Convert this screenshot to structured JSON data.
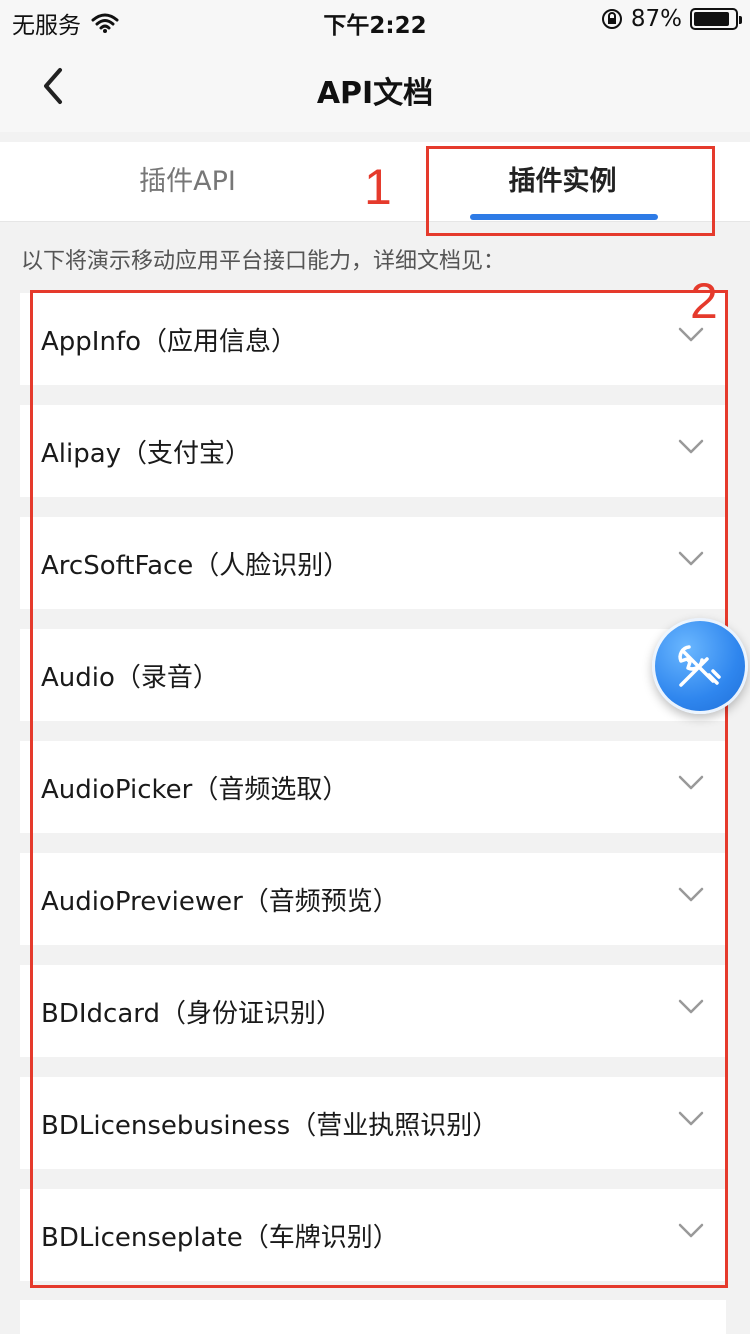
{
  "status_bar": {
    "carrier": "无服务",
    "time": "下午2:22",
    "battery_percent": "87%",
    "battery_level": 0.87
  },
  "nav": {
    "title": "API文档"
  },
  "tabs": [
    {
      "label": "插件API",
      "active": false
    },
    {
      "label": "插件实例",
      "active": true
    }
  ],
  "annotations": {
    "marker1": "1",
    "marker2": "2",
    "color": "#e53a2c"
  },
  "intro": "以下将演示移动应用平台接口能力，详细文档见：",
  "items": [
    {
      "label": "AppInfo（应用信息）"
    },
    {
      "label": "Alipay（支付宝）"
    },
    {
      "label": "ArcSoftFace（人脸识别）"
    },
    {
      "label": "Audio（录音）"
    },
    {
      "label": "AudioPicker（音频选取）"
    },
    {
      "label": "AudioPreviewer（音频预览）"
    },
    {
      "label": "BDIdcard（身份证识别）"
    },
    {
      "label": "BDLicensebusiness（营业执照识别）"
    },
    {
      "label": "BDLicenseplate（车牌识别）"
    }
  ],
  "icons": {
    "back": "chevron-left-icon",
    "expand": "chevron-down-icon",
    "fab": "tools-icon",
    "wifi": "wifi-icon",
    "rotation_lock": "rotation-lock-icon",
    "battery": "battery-icon"
  },
  "colors": {
    "accent": "#2e7be6",
    "background": "#f2f2f2",
    "annotation": "#e53a2c"
  }
}
